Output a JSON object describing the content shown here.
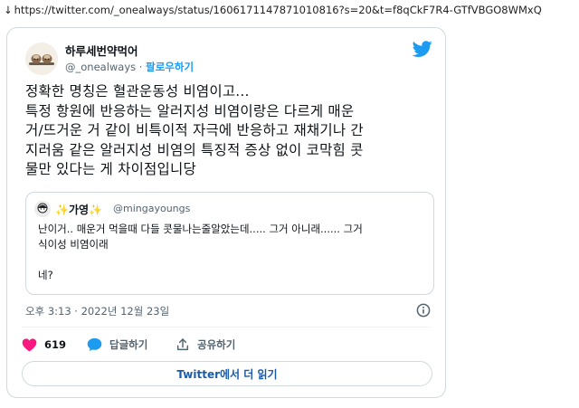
{
  "browser": {
    "arrow": "↓",
    "url": "https://twitter.com/_onealways/status/1606171147871010816?s=20&t=f8qCkF7R4-GTfVBGO8WMxQ"
  },
  "tweet": {
    "author_name": "하루세번약먹어",
    "handle": "@_onealways",
    "separator": " · ",
    "follow_label": "팔로우하기",
    "text": "정확한 명칭은 혈관운동성 비염이고...\n특정 항원에 반응하는 알러지성 비염이랑은 다르게 매운\n거/뜨거운 거 같이 비특이적 자극에 반응하고 재채기나 간\n지러움 같은 알러지성 비염의 특징적 증상 없이 코막힘 콧\n물만 있다는 게 차이점입니당",
    "timestamp": "오후 3:13 · 2022년 12월 23일",
    "like_count": "619",
    "reply_label": "답글하기",
    "share_label": "공유하기",
    "read_more_label": "Twitter에서 더 읽기"
  },
  "quoted": {
    "name_spark_left": "✨",
    "name": "가영",
    "name_spark_right": "✨",
    "handle": "@mingayoungs",
    "text": "난이거.. 매운거 먹을때 다들 콧물나는줄알았는데..... 그거 아니래...... 그거\n식이성 비염이래\n\n네?"
  },
  "colors": {
    "twitter_blue": "#1d9bf0",
    "like_red": "#f91880",
    "muted_text": "#536471",
    "border": "#cfd9de"
  },
  "icons": [
    "twitter-bird-icon",
    "info-icon",
    "heart-icon",
    "reply-bubble-icon",
    "share-icon"
  ]
}
